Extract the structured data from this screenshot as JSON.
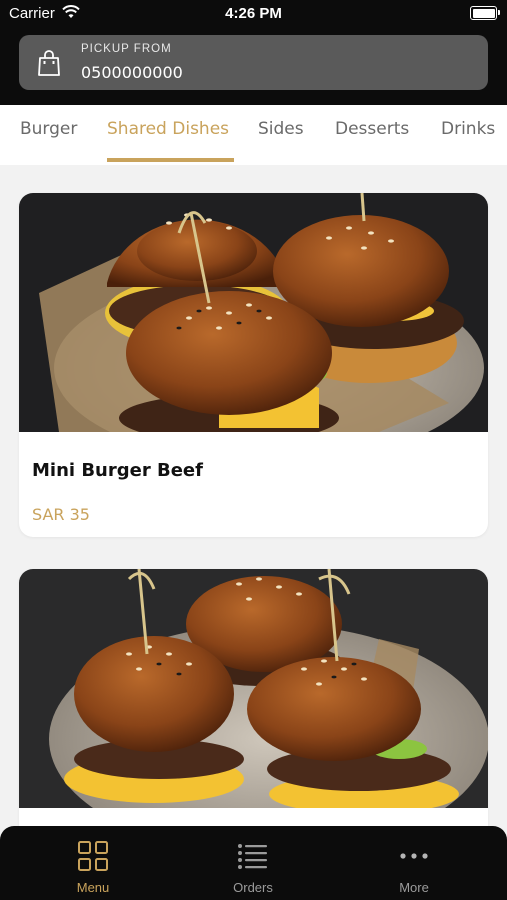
{
  "status_bar": {
    "carrier": "Carrier",
    "time": "4:26 PM"
  },
  "pickup": {
    "label": "PICKUP FROM",
    "phone": "0500000000"
  },
  "categories": [
    "Burger",
    "Shared Dishes",
    "Sides",
    "Desserts",
    "Drinks"
  ],
  "active_category": "Shared Dishes",
  "products": [
    {
      "name": "Mini Burger Beef",
      "price": "SAR 35"
    },
    {
      "name": "",
      "price": ""
    }
  ],
  "nav": [
    {
      "label": "Menu",
      "icon": "grid-icon",
      "active": true
    },
    {
      "label": "Orders",
      "icon": "list-icon",
      "active": false
    },
    {
      "label": "More",
      "icon": "dots-icon",
      "active": false
    }
  ],
  "colors": {
    "accent": "#c9a35c",
    "header": "#0c0c0c",
    "pickup_bg": "#5a5a5a",
    "page_bg": "#f2f2f2"
  }
}
